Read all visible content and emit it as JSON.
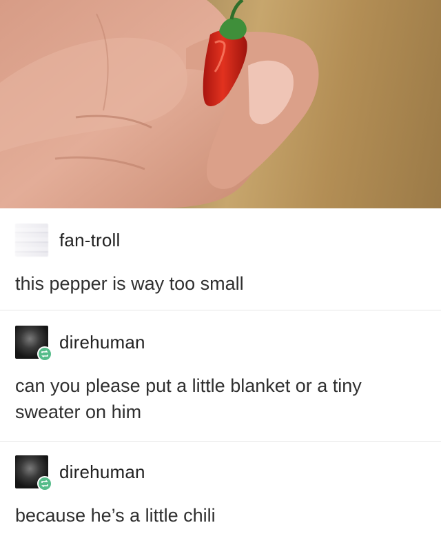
{
  "image": {
    "subject": "hand holding tiny red chili pepper"
  },
  "posts": [
    {
      "username": "fan-troll",
      "text": "this pepper is way too small",
      "avatar_style": "blurred",
      "reblog_badge": false
    },
    {
      "username": "direhuman",
      "text": "can you please put a little blanket or a tiny sweater on him",
      "avatar_style": "dark",
      "reblog_badge": true
    },
    {
      "username": "direhuman",
      "text": "because he’s a little chili",
      "avatar_style": "dark",
      "reblog_badge": true
    }
  ],
  "colors": {
    "reblog_badge": "#56bc8a",
    "pepper": "#d8281c",
    "stem": "#3f8f3a",
    "text": "#2f2f2f"
  },
  "icons": {
    "reblog": "reblog-icon"
  }
}
